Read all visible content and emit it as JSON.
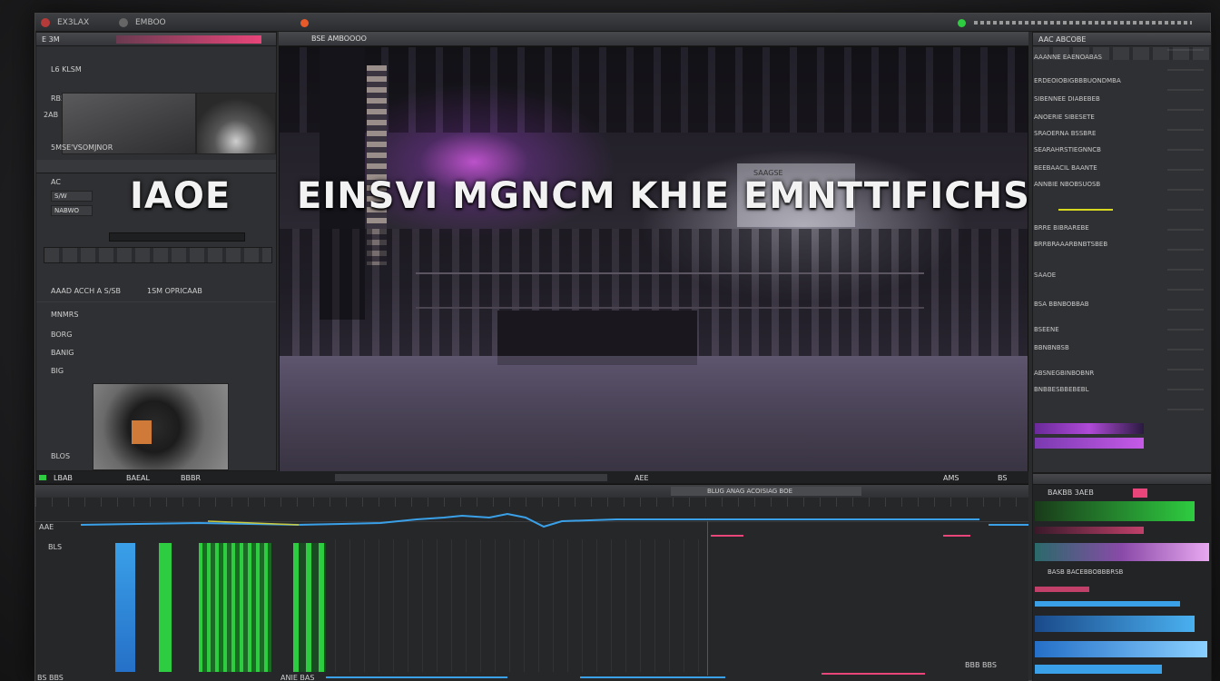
{
  "app": {
    "title": "EX3LAX",
    "menu_item": "EMBOO",
    "colors": {
      "accent_pink": "#e8457a",
      "accent_green": "#2ecc40",
      "accent_blue": "#3aa0e8",
      "accent_purple": "#b04ad8"
    }
  },
  "left_panel": {
    "tab_label": "E 3M",
    "header_text": "RB5IQKAG",
    "list_label": "L6 KLSM",
    "thumb_label": "2AB",
    "caption": "5MSE'VSOMJNOR",
    "section_labels": [
      "AC",
      "S/W",
      "NABWO"
    ],
    "props_left": "AAAD ACCH A S/SB",
    "props_right": "1SM OPRICAAB",
    "items": [
      "MNMRS",
      "BORG",
      "BANIG",
      "BIG"
    ],
    "bottom_item": "BLOS"
  },
  "viewer": {
    "toolbar_label": "BSE AMBOOOO",
    "headline_left": "IAOE",
    "headline_main": "EINSVI MGNCM KHIE EMNTTIFICHS",
    "background_sign": "SAAGSE"
  },
  "transport": {
    "labels": [
      "LBAB",
      "BAEAL",
      "BBBR",
      "AEE",
      "AMS",
      "BS"
    ]
  },
  "timeline": {
    "top_label": "BLUG  ANAG  ACOISIAG  BOE",
    "track_labels": [
      "AAE",
      "BLS"
    ],
    "footer_label": "BBB BBS",
    "bottom_left": "BS BBS",
    "bottom_right": "ANIE BAS"
  },
  "right_panel": {
    "header": "AAC ABCOBE",
    "rows": [
      "AAANNE EAENOABAS",
      "ERDEOIOBIGBBBUONDMBA",
      "SIBENNEE DIABEBEB",
      "ANOERIE SIBESETE",
      "SRAOERNA BSSBRE",
      "SEARAHRSTIEGNNCB",
      "BEEBAACIL BAANTE",
      "ANNBIE NBOBSUOSB",
      "BRRE BIBRAREBE",
      "BRRBRAAARBNBTSBEB",
      "SAAOE",
      "BSA BBNBOBBAB",
      "BSEENE",
      "BBNBNBSB",
      "ABSNEGBINBOBNR",
      "BNBBESBBEBEBL"
    ],
    "scope_header": "BAKBB 3AEB",
    "scope_label": "BASB BACEBBOBBBRSB"
  }
}
